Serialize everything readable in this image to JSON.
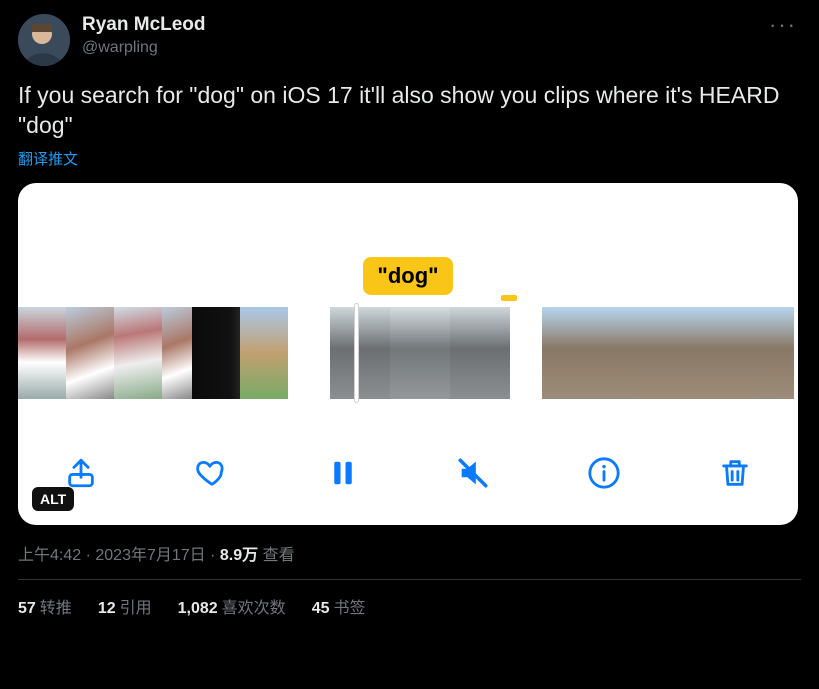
{
  "author": {
    "name": "Ryan McLeod",
    "handle": "@warpling"
  },
  "tweet_text": "If you search for \"dog\" on iOS 17 it'll also show you clips where it's HEARD \"dog\"",
  "translate_label": "翻译推文",
  "media": {
    "callout": "\"dog\"",
    "alt_badge": "ALT",
    "toolbar": {
      "share": "share",
      "like": "like",
      "pause": "pause",
      "mute": "mute",
      "info": "info",
      "delete": "delete"
    }
  },
  "meta": {
    "time": "上午4:42",
    "date": "2023年7月17日",
    "views_number": "8.9万",
    "views_label": "查看",
    "dot": " · "
  },
  "stats": {
    "retweets_n": "57",
    "retweets_l": "转推",
    "quotes_n": "12",
    "quotes_l": "引用",
    "likes_n": "1,082",
    "likes_l": "喜欢次数",
    "bookmarks_n": "45",
    "bookmarks_l": "书签"
  }
}
